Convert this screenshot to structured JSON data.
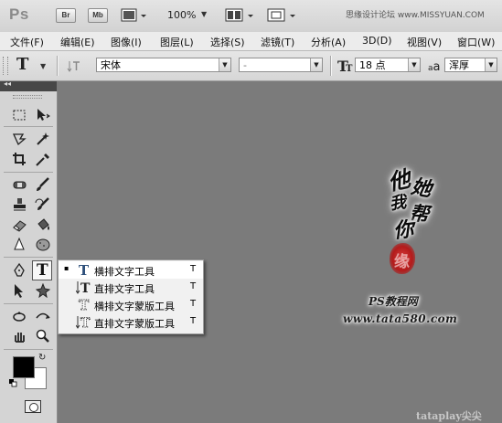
{
  "app_bar": {
    "logo": "Ps",
    "bridge_button": "Br",
    "minibridge_button": "Mb",
    "zoom": "100%",
    "watermark": "思缘设计论坛 www.MISSYUAN.COM"
  },
  "menu": [
    "文件(F)",
    "编辑(E)",
    "图像(I)",
    "图层(L)",
    "选择(S)",
    "滤镜(T)",
    "分析(A)",
    "3D(D)",
    "视图(V)",
    "窗口(W)"
  ],
  "options_bar": {
    "tool_glyph": "T",
    "font_family": "宋体",
    "font_style": "-",
    "font_size": "18 点",
    "aa_label": "a",
    "aa_label_small": "a",
    "antialias": "浑厚"
  },
  "tools_panel": {
    "collapse_glyph": "◂◂",
    "fg_color": "#000000",
    "bg_color": "#ffffff"
  },
  "flyout": {
    "items": [
      {
        "label": "横排文字工具",
        "shortcut": "T",
        "selected": true
      },
      {
        "label": "直排文字工具",
        "shortcut": "T",
        "selected": false
      },
      {
        "label": "横排文字蒙版工具",
        "shortcut": "T",
        "selected": false
      },
      {
        "label": "直排文字蒙版工具",
        "shortcut": "T",
        "selected": false
      }
    ],
    "selected_marker": "▪"
  },
  "canvas": {
    "background": "#7b7b7b",
    "calligraphy": [
      "他",
      "她",
      "我",
      "帮",
      "你"
    ],
    "seal_text": "缘",
    "site_label": "PS教程网",
    "site_url": "www.tata580.com",
    "bottom_watermark": "tataplay尖尖"
  }
}
